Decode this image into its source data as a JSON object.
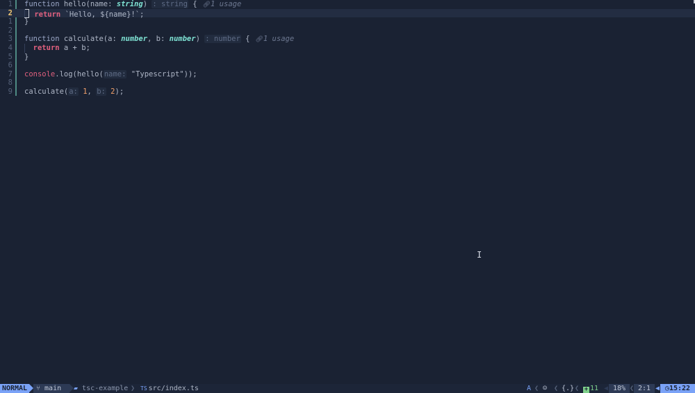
{
  "editor": {
    "lines": [
      {
        "num": "1",
        "tokens": [
          {
            "t": "function ",
            "c": "kw"
          },
          {
            "t": "hello(name: ",
            "c": "fn"
          },
          {
            "t": "string",
            "c": "ty"
          },
          {
            "t": ") ",
            "c": "punc"
          },
          {
            "t": ": string",
            "c": "hint"
          },
          {
            "t": " {",
            "c": "punc"
          },
          {
            "t": "1 usage",
            "c": "usage"
          }
        ]
      },
      {
        "num": "2",
        "current": true,
        "tokens": [
          {
            "t": "return",
            "c": "kw-ret"
          },
          {
            "t": " `Hello, ${name}!`;",
            "c": "str"
          }
        ]
      },
      {
        "num": "1",
        "tokens": [
          {
            "t": "}",
            "c": "punc"
          }
        ]
      },
      {
        "num": "2",
        "tokens": []
      },
      {
        "num": "3",
        "tokens": [
          {
            "t": "function ",
            "c": "kw"
          },
          {
            "t": "calculate(a: ",
            "c": "fn"
          },
          {
            "t": "number",
            "c": "ty"
          },
          {
            "t": ", b: ",
            "c": "fn"
          },
          {
            "t": "number",
            "c": "ty"
          },
          {
            "t": ") ",
            "c": "punc"
          },
          {
            "t": ": number",
            "c": "hint"
          },
          {
            "t": " {",
            "c": "punc"
          },
          {
            "t": "1 usage",
            "c": "usage"
          }
        ]
      },
      {
        "num": "4",
        "tokens": [
          {
            "t": "return",
            "c": "kw-ret"
          },
          {
            "t": " a + b;",
            "c": "fn"
          }
        ]
      },
      {
        "num": "5",
        "tokens": [
          {
            "t": "}",
            "c": "punc"
          }
        ]
      },
      {
        "num": "6",
        "tokens": []
      },
      {
        "num": "7",
        "tokens": [
          {
            "t": "console",
            "c": "kw-ret-lite"
          },
          {
            "t": ".log(hello(",
            "c": "fn"
          },
          {
            "t": "name:",
            "c": "hint"
          },
          {
            "t": " \"Typescript\"));",
            "c": "str"
          }
        ]
      },
      {
        "num": "8",
        "tokens": []
      },
      {
        "num": "9",
        "tokens": [
          {
            "t": "calculate(",
            "c": "fn"
          },
          {
            "t": "a:",
            "c": "hint"
          },
          {
            "t": " 1",
            "c": "num"
          },
          {
            "t": ", ",
            "c": "fn"
          },
          {
            "t": "b:",
            "c": "hint"
          },
          {
            "t": " 2",
            "c": "num"
          },
          {
            "t": ");",
            "c": "fn"
          }
        ]
      }
    ]
  },
  "statusline": {
    "mode": "NORMAL",
    "branch_icon": "git-branch-icon",
    "branch": "main",
    "project_icon": "folder-icon",
    "project": "tsc-example",
    "file_tag": "TS",
    "file": "src/index.ts",
    "lsp_indicator": "A",
    "copilot_icon": "copilot-icon",
    "braces": "{.}",
    "diagnostics_count": "11",
    "percent": "18%",
    "position": "2:1",
    "clock_icon": "clock-icon",
    "time": "15:22"
  },
  "colors": {
    "background": "#1a2233",
    "mode_accent": "#7aa2f7",
    "keyword_return": "#e0607e",
    "type": "#7fe3d4",
    "number": "#f2a06a",
    "current_line_number": "#f0c674"
  }
}
